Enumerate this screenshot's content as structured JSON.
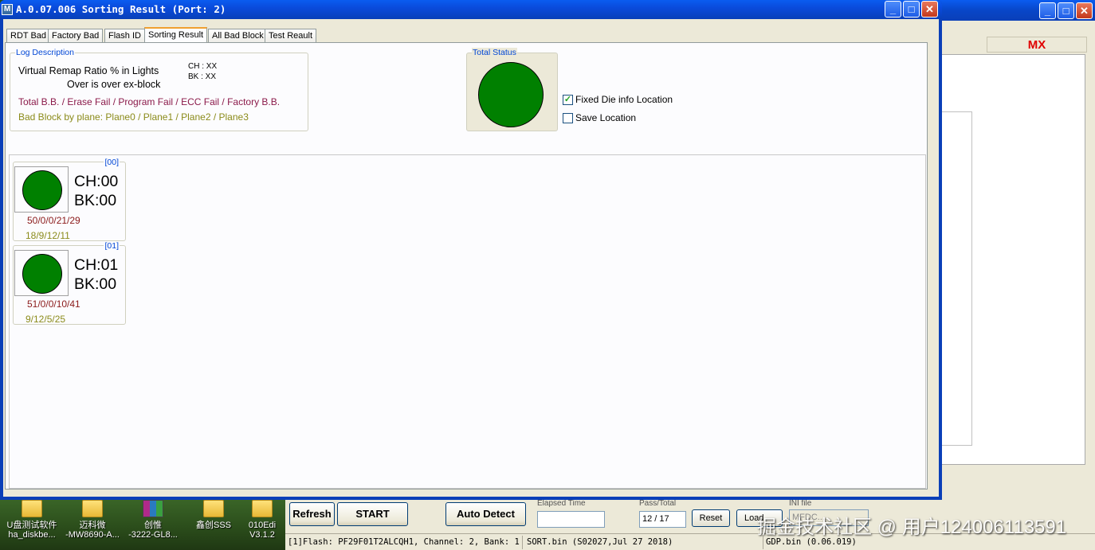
{
  "window": {
    "icon": "M",
    "title": "A.0.07.006 Sorting Result (Port: 2)",
    "min": "_",
    "max": "□",
    "close": "✕"
  },
  "tabs": [
    {
      "label": "RDT Bad"
    },
    {
      "label": "Factory Bad"
    },
    {
      "label": "Flash ID"
    },
    {
      "label": "Sorting Result",
      "active": true
    },
    {
      "label": "All Bad Block"
    },
    {
      "label": "Test Reault"
    }
  ],
  "log_description": {
    "title": "Log Description",
    "line1": "Virtual Remap Ratio % in Lights",
    "line2": "Over is over ex-block",
    "ch": "CH : XX",
    "bk": "BK : XX",
    "line3": "Total B.B. / Erase Fail / Program Fail / ECC Fail / Factory B.B.",
    "line4": "Bad Block by plane: Plane0 / Plane1 / Plane2 / Plane3"
  },
  "total_status": {
    "title": "Total Status",
    "color": "#008000"
  },
  "options": {
    "fixed_die": {
      "label": "Fixed Die info Location",
      "checked": true,
      "mark": "✓"
    },
    "save_location": {
      "label": "Save Location",
      "checked": false
    }
  },
  "dies": [
    {
      "index": "[00]",
      "ch": "CH:00",
      "bk": "BK:00",
      "line1": "50/0/0/21/29",
      "line2": "18/9/12/11",
      "color": "#008000"
    },
    {
      "index": "[01]",
      "ch": "CH:01",
      "bk": "BK:00",
      "line1": "51/0/0/10/41",
      "line2": "9/12/5/25",
      "color": "#008000"
    }
  ],
  "background_app": {
    "vendor": "MX"
  },
  "toolbar": {
    "refresh": "Refresh",
    "start": "START",
    "auto_detect": "Auto Detect",
    "elapsed_label": "Elapsed Time",
    "elapsed_value": "",
    "pass_total_label": "Pass/Total",
    "pass_total_value": "12 / 17",
    "reset": "Reset",
    "load": "Load",
    "ini_label": "INI file",
    "ini_value": "MFDC..."
  },
  "status": {
    "flash": "[1]Flash: PF29F01T2ALCQH1, Channel: 2, Bank: 1",
    "sort": "SORT.bin (S02027,Jul 27 2018)",
    "gdp": "GDP.bin (0.06.019)"
  },
  "desktop_icons": [
    {
      "label1": "U盘测试软件",
      "label2": "ha_diskbe...",
      "type": "folder"
    },
    {
      "label1": "迈科微",
      "label2": "-MW8690-A...",
      "type": "folder"
    },
    {
      "label1": "创惟",
      "label2": "-3222-GL8...",
      "type": "rar"
    },
    {
      "label1": "鑫创SSS",
      "label2": "",
      "type": "folder"
    },
    {
      "label1": "010Edi",
      "label2": "V3.1.2",
      "type": "folder"
    }
  ],
  "watermark": "掘金技术社区 @ 用户124006113591"
}
